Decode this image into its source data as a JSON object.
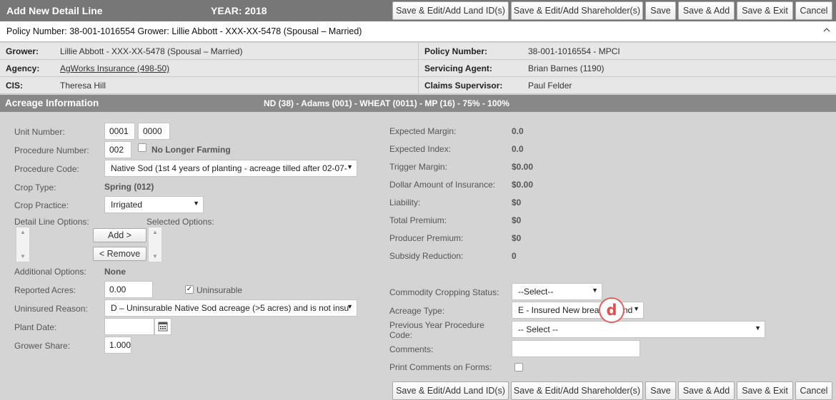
{
  "header": {
    "title": "Add New Detail Line",
    "year": "YEAR: 2018",
    "buttons": {
      "land": "Save & Edit/Add Land ID(s)",
      "shareholder": "Save & Edit/Add Shareholder(s)",
      "save": "Save",
      "save_add": "Save & Add",
      "save_exit": "Save & Exit",
      "cancel": "Cancel"
    }
  },
  "policy_bar": {
    "text": "Policy Number: 38-001-1016554 Grower: Lillie Abbott - XXX-XX-5478 (Spousal – Married)",
    "collapse_icon": "chevron-up-icon"
  },
  "info": {
    "grower_label": "Grower:",
    "grower_value": "Lillie Abbott - XXX-XX-5478 (Spousal – Married)",
    "agency_label": "Agency:",
    "agency_value": "AgWorks Insurance (498-50)",
    "cis_label": "CIS:",
    "cis_value": "Theresa Hill",
    "policy_label": "Policy Number:",
    "policy_value": "38-001-1016554 - MPCI",
    "agent_label": "Servicing Agent:",
    "agent_value": "Brian Barnes (1190)",
    "claims_label": "Claims Supervisor:",
    "claims_value": "Paul Felder"
  },
  "section": {
    "title": "Acreage Information",
    "summary": "ND (38) - Adams (001) - WHEAT (0011) - MP (16) - 75% - 100%"
  },
  "form": {
    "unit_number_label": "Unit Number:",
    "unit_number_1": "0001",
    "unit_number_2": "0000",
    "procedure_number_label": "Procedure Number:",
    "procedure_number": "002",
    "no_longer_farming_label": "No Longer Farming",
    "no_longer_farming_checked": false,
    "procedure_code_label": "Procedure Code:",
    "procedure_code_value": "Native Sod (1st 4 years of planting - acreage tilled after 02-07-",
    "crop_type_label": "Crop Type:",
    "crop_type_value": "Spring (012)",
    "crop_practice_label": "Crop Practice:",
    "crop_practice_value": "Irrigated",
    "detail_line_options_label": "Detail Line Options:",
    "selected_options_label": "Selected Options:",
    "add_button": "Add >",
    "remove_button": "< Remove",
    "additional_options_label": "Additional Options:",
    "additional_options_value": "None",
    "reported_acres_label": "Reported Acres:",
    "reported_acres_value": "0.00",
    "uninsurable_label": "Uninsurable",
    "uninsurable_checked": true,
    "uninsured_reason_label": "Uninsured Reason:",
    "uninsured_reason_value": "D – Uninsurable Native Sod acreage (>5 acres) and is not insu",
    "plant_date_label": "Plant Date:",
    "plant_date_value": "",
    "grower_share_label": "Grower Share:",
    "grower_share_value": "1.000"
  },
  "summary": {
    "expected_margin_label": "Expected Margin:",
    "expected_margin_value": "0.0",
    "expected_index_label": "Expected Index:",
    "expected_index_value": "0.0",
    "trigger_margin_label": "Trigger Margin:",
    "trigger_margin_value": "$0.00",
    "dollar_amount_label": "Dollar Amount of Insurance:",
    "dollar_amount_value": "$0.00",
    "liability_label": "Liability:",
    "liability_value": "$0",
    "total_premium_label": "Total Premium:",
    "total_premium_value": "$0",
    "producer_premium_label": "Producer Premium:",
    "producer_premium_value": "$0",
    "subsidy_reduction_label": "Subsidy Reduction:",
    "subsidy_reduction_value": "0",
    "commodity_status_label": "Commodity Cropping Status:",
    "commodity_status_value": "--Select--",
    "acreage_type_label": "Acreage Type:",
    "acreage_type_value": "E - Insured New brea",
    "acreage_type_tail": "nd",
    "prev_year_label_line1": "Previous Year Procedure",
    "prev_year_label_line2": "Code:",
    "prev_year_value": "-- Select --",
    "comments_label": "Comments:",
    "comments_value": "",
    "print_comments_label": "Print Comments on Forms:",
    "print_comments_checked": false
  },
  "annotation": {
    "badge_letter": "d",
    "badge_color": "#e05050"
  },
  "colors": {
    "title_bar": "#777777",
    "section_bar": "#888888",
    "info_bg": "#e7e7e7",
    "form_bg": "#d4d4d4"
  }
}
